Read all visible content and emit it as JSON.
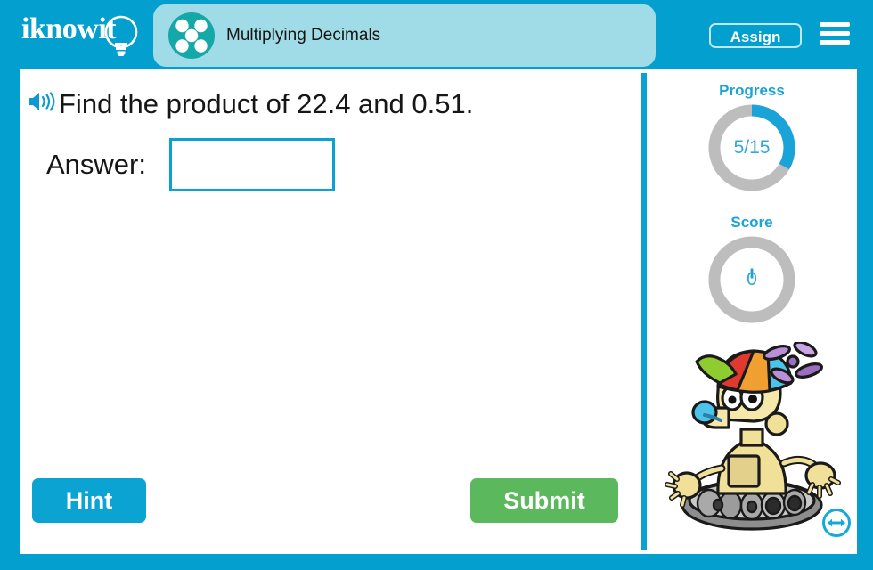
{
  "header": {
    "logo_text": "iknowit",
    "logo_icon": "lightbulb-icon",
    "lesson_icon": "five-dots-icon",
    "lesson_title": "Multiplying Decimals",
    "assign_label": "Assign",
    "menu_icon": "hamburger-menu-icon"
  },
  "question": {
    "audio_icon": "speaker-icon",
    "text": "Find the product of 22.4 and 0.51.",
    "answer_label": "Answer:",
    "answer_value": "",
    "answer_placeholder": ""
  },
  "footer": {
    "hint_label": "Hint",
    "submit_label": "Submit"
  },
  "panel": {
    "progress": {
      "title": "Progress",
      "value": "5/15",
      "current": 5,
      "total": 15,
      "percent": 33.3
    },
    "score": {
      "title": "Score",
      "value": "0",
      "current": 0,
      "percent": 0
    },
    "mascot_icon": "robot-mascot-icon",
    "resize_icon": "horizontal-resize-arrows-icon"
  },
  "colors": {
    "frame_blue": "#039fce",
    "accent_blue": "#09a2d1",
    "title_tab": "#9fdce8",
    "lesson_icon_teal": "#16a8a8",
    "submit_green": "#5cb85c",
    "gauge_track_gray": "#bdbdbd",
    "gauge_fill_blue": "#1aa3d8"
  }
}
